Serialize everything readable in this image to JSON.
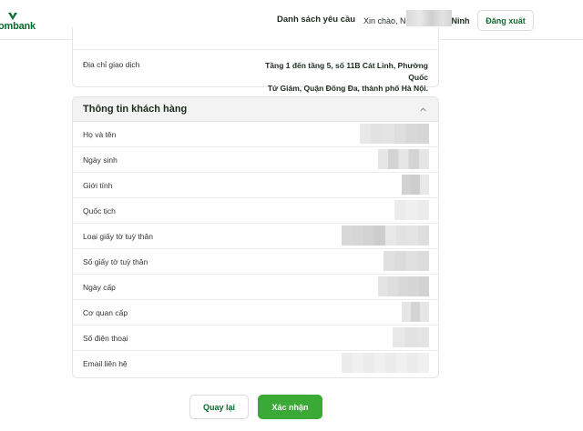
{
  "header": {
    "logo_text": "ombank",
    "nav_link": "Danh sách yêu cầu",
    "greeting_prefix": "Xin chào, N",
    "greeting_suffix": "Ninh",
    "logout_label": "Đăng xuất"
  },
  "transaction_card": {
    "address_label": "Địa chỉ giao dịch",
    "address_line1": "Tầng 1 đến tầng 5, số 11B Cát Linh, Phường Quốc",
    "address_line2": "Tử Giám, Quận Đống Đa, thành phố Hà Nội."
  },
  "customer_card": {
    "title": "Thông tin khách hàng",
    "rows": [
      {
        "label": "Họ và tên"
      },
      {
        "label": "Ngày sinh"
      },
      {
        "label": "Giới tính"
      },
      {
        "label": "Quốc tịch"
      },
      {
        "label": "Loại giấy tờ tuỳ thân"
      },
      {
        "label": "Số giấy tờ tuỳ thân"
      },
      {
        "label": "Ngày cấp"
      },
      {
        "label": "Cơ quan cấp"
      },
      {
        "label": "Số điện thoại"
      },
      {
        "label": "Email liên hệ"
      }
    ]
  },
  "footer": {
    "back_label": "Quay lại",
    "confirm_label": "Xác nhận"
  },
  "colors": {
    "brand_green": "#0a6b2e",
    "confirm_green": "#3aa935"
  },
  "icons": {
    "logo": "bank-logo-icon",
    "collapse": "chevron-up-icon"
  }
}
